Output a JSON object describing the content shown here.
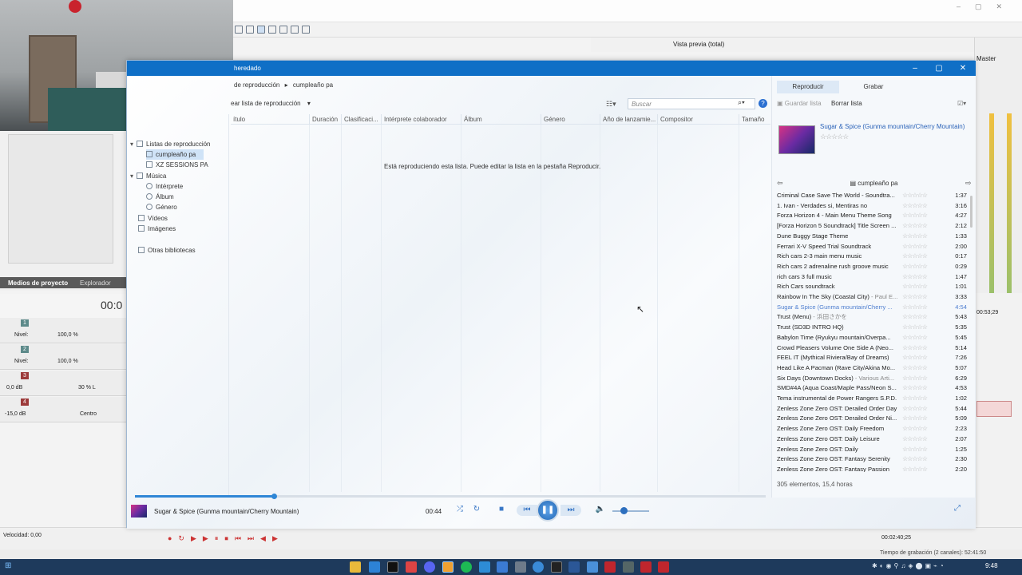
{
  "background_app": {
    "vista_previa": "Vista previa (total)",
    "master_label": "Master",
    "tabs": [
      "Medios de proyecto",
      "Explorador"
    ],
    "timecode": "00:0",
    "tracks": [
      {
        "num": "1",
        "nivel": "Nivel:",
        "pct": "100,0 %"
      },
      {
        "num": "2",
        "nivel": "Nivel:",
        "pct": "100,0 %"
      },
      {
        "num": "3",
        "db": "0,0 dB",
        "pan": "30 % L"
      },
      {
        "num": "4",
        "db": "-15,0 dB",
        "pan": "Centro"
      }
    ],
    "velocidad": "Velocidad: 0,00",
    "status_time": "00:02:40;25",
    "grabacion": "Tiempo de grabación (2 canales): 52:41:50",
    "right_time": "00:53;29"
  },
  "player": {
    "title": "heredado",
    "breadcrumb": [
      "de reproducción",
      "cumpleaño pa"
    ],
    "create_label": "ear lista de reproducción",
    "search_placeholder": "Buscar",
    "columns": [
      "ítulo",
      "Duración",
      "Clasificaci...",
      "Intérprete colaborador",
      "Álbum",
      "Género",
      "Año de lanzamie...",
      "Compositor",
      "Tamaño"
    ],
    "nav": [
      {
        "label": "Listas de reproducción",
        "type": "group"
      },
      {
        "label": "cumpleaño pa",
        "type": "item",
        "selected": true
      },
      {
        "label": "XZ SESSIONS PA",
        "type": "item"
      },
      {
        "label": "Música",
        "type": "group"
      },
      {
        "label": "Intérprete",
        "type": "item"
      },
      {
        "label": "Álbum",
        "type": "item"
      },
      {
        "label": "Género",
        "type": "item"
      },
      {
        "label": "Vídeos",
        "type": "root"
      },
      {
        "label": "Imágenes",
        "type": "root"
      },
      {
        "label": "Otras bibliotecas",
        "type": "root"
      }
    ],
    "empty_message": "Está reproduciendo esta lista. Puede editar la lista en la pestaña Reproducir.",
    "right_panel": {
      "tabs": [
        "Reproducir",
        "Grabar"
      ],
      "active_tab": "Reproducir",
      "guardar": "Guardar lista",
      "borrar": "Borrar lista",
      "now_playing_title": "Sugar & Spice (Gunma mountain/Cherry Mountain)",
      "stars": "☆☆☆☆☆",
      "list_name": "cumpleaño pa",
      "footer": "305 elementos, 15,4 horas",
      "tracks": [
        {
          "title": "Criminal Case Save The World - Soundtra...",
          "artist": "",
          "dur": "1:37"
        },
        {
          "title": "1. Ivan - Verdades si, Mentiras no",
          "artist": "",
          "dur": "3:16"
        },
        {
          "title": "Forza Horizon 4 - Main Menu Theme Song",
          "artist": "",
          "dur": "4:27"
        },
        {
          "title": "[Forza Horizon 5 Soundtrack] Title Screen ...",
          "artist": "",
          "dur": "2:12"
        },
        {
          "title": "Dune Buggy Stage Theme",
          "artist": "",
          "dur": "1:33"
        },
        {
          "title": "Ferrari X-V Speed Trial Soundtrack",
          "artist": "",
          "dur": "2:00"
        },
        {
          "title": "Rich cars 2-3 main menu music",
          "artist": "",
          "dur": "0:17"
        },
        {
          "title": "Rich cars 2 adrenaline rush groove music",
          "artist": "",
          "dur": "0:29"
        },
        {
          "title": "rich cars 3 full music",
          "artist": "",
          "dur": "1:47"
        },
        {
          "title": "Rich Cars soundtrack",
          "artist": "",
          "dur": "1:01"
        },
        {
          "title": "Rainbow In The Sky (Coastal City)",
          "artist": " - Paul E...",
          "dur": "3:33"
        },
        {
          "title": "Sugar & Spice (Gunma mountain/Cherry ...",
          "artist": "",
          "dur": "4:54",
          "playing": true
        },
        {
          "title": "Trust (Menu)",
          "artist": " - 浜田さかを",
          "dur": "5:43"
        },
        {
          "title": "Trust (SD3D INTRO HQ)",
          "artist": "",
          "dur": "5:35"
        },
        {
          "title": "Babylon Time (Ryukyu mountain/Overpa...",
          "artist": "",
          "dur": "5:45"
        },
        {
          "title": "Crowd Pleasers Volume One Side A (Neo...",
          "artist": "",
          "dur": "5:14"
        },
        {
          "title": "FEEL IT (Mythical Riviera/Bay of Dreams)",
          "artist": "",
          "dur": "7:26"
        },
        {
          "title": "Head Like A Pacman (Rave City/Akina Mo...",
          "artist": "",
          "dur": "5:07"
        },
        {
          "title": "Six Days (Downtown Docks)",
          "artist": " - Various Arti...",
          "dur": "6:29"
        },
        {
          "title": "SMD#4A (Aqua Coast/Maple Pass/Neon S...",
          "artist": "",
          "dur": "4:53"
        },
        {
          "title": "Tema instrumental de Power Rangers S.P.D.",
          "artist": "",
          "dur": "1:02"
        },
        {
          "title": "Zenless Zone Zero OST: Derailed Order Day",
          "artist": "",
          "dur": "5:44"
        },
        {
          "title": "Zenless Zone Zero OST: Derailed Order Ni...",
          "artist": "",
          "dur": "5:09"
        },
        {
          "title": "Zenless Zone Zero OST: Daily Freedom",
          "artist": "",
          "dur": "2:23"
        },
        {
          "title": "Zenless Zone Zero OST: Daily Leisure",
          "artist": "",
          "dur": "2:07"
        },
        {
          "title": "Zenless Zone Zero OST: Daily",
          "artist": "",
          "dur": "1:25"
        },
        {
          "title": "Zenless Zone Zero OST: Fantasy Serenity",
          "artist": "",
          "dur": "2:30"
        },
        {
          "title": "Zenless Zone Zero OST: Fantasy Passion",
          "artist": "",
          "dur": "2:20"
        }
      ]
    },
    "now_playing": "Sugar & Spice (Gunma mountain/Cherry Mountain)",
    "elapsed": "00:44",
    "seek_fraction": 0.22,
    "volume_fraction": 0.3
  },
  "taskbar": {
    "time": "9:48"
  },
  "colors": {
    "title_bar": "#0f6fc6",
    "accent": "#2f86d6",
    "taskbar": "#1e3a5c",
    "playing_text": "#4f7fd0"
  }
}
